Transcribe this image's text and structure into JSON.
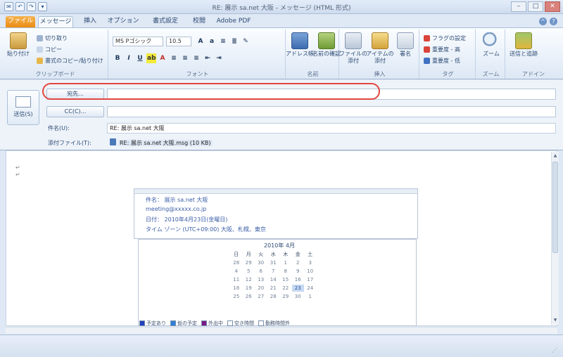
{
  "window": {
    "title": "RE: 展示 sa.net 大阪 - メッセージ (HTML 形式)",
    "minimize": "–",
    "maximize": "□",
    "close": "✕"
  },
  "qat": [
    "✉",
    "↶",
    "↷",
    "▾"
  ],
  "tabs": [
    {
      "label": "ファイル"
    },
    {
      "label": "メッセージ"
    },
    {
      "label": "挿入"
    },
    {
      "label": "オプション"
    },
    {
      "label": "書式設定"
    },
    {
      "label": "校閲"
    },
    {
      "label": "Adobe PDF"
    }
  ],
  "ribbon": {
    "clipboard": {
      "paste": "貼り付け",
      "cut": "切り取り",
      "copy": "コピー",
      "format_painter": "書式のコピー/貼り付け",
      "label": "クリップボード"
    },
    "font": {
      "font_name": "MS Pゴシック",
      "font_size": "10.5",
      "label": "フォント",
      "bold": "B",
      "italic": "I",
      "underline": "U"
    },
    "names": {
      "address_book": "アドレス帳",
      "check_names": "名前の確認",
      "label": "名前"
    },
    "include": {
      "attach_file": "ファイルの添付",
      "attach_item": "アイテムの添付",
      "signature": "署名",
      "label": "挿入"
    },
    "tags": {
      "followup": "フラグの設定",
      "high_importance": "重要度 - 高",
      "low_importance": "重要度 - 低",
      "label": "タグ"
    },
    "zoom": {
      "zoom": "ズーム",
      "label": "ズーム"
    },
    "onenote": {
      "send": "送信と追跡",
      "label": "アドイン"
    }
  },
  "header": {
    "send_label": "送信(S)",
    "to_button": "宛先...",
    "cc_button": "CC(C)...",
    "subject_label": "件名(U):",
    "subject_value": "RE: 展示 sa.net 大阪",
    "attach_label": "添付ファイル(T):",
    "attachment_name": "RE: 展示 sa.net 大阪.msg (10 KB)"
  },
  "body": {
    "lines_marks": [
      "↵",
      "↵"
    ],
    "info_lines": [
      "件名： 展示 sa.net 大阪",
      "meeting@xxxxx.co.jp",
      "日付： 2010年4月23日(金曜日)",
      "タイム ゾーン (UTC+09:00) 大阪、札幌、東京"
    ],
    "calendar": {
      "month": "2010年 4月",
      "dow": [
        "日",
        "月",
        "火",
        "水",
        "木",
        "金",
        "土",
        ""
      ],
      "weeks": [
        [
          "28",
          "29",
          "30",
          "31",
          "1",
          "2",
          "3",
          ""
        ],
        [
          "4",
          "5",
          "6",
          "7",
          "8",
          "9",
          "10",
          ""
        ],
        [
          "11",
          "12",
          "13",
          "14",
          "15",
          "16",
          "17",
          ""
        ],
        [
          "18",
          "19",
          "20",
          "21",
          "22",
          "23",
          "24",
          ""
        ],
        [
          "25",
          "26",
          "27",
          "28",
          "29",
          "30",
          "1",
          ""
        ]
      ],
      "today": "23"
    },
    "legend": [
      {
        "label": "予定あり",
        "color": "#1f3fbf"
      },
      {
        "label": "仮の予定",
        "color": "#2d7fd8"
      },
      {
        "label": "外出中",
        "color": "#7a1a8a"
      },
      {
        "label": "空き時間",
        "color": "#ffffff"
      },
      {
        "label": "勤務時間外",
        "color": "#ffffff"
      }
    ]
  },
  "colors": {
    "highlight": "#e2473f",
    "file_tab": "#ea8a11"
  }
}
